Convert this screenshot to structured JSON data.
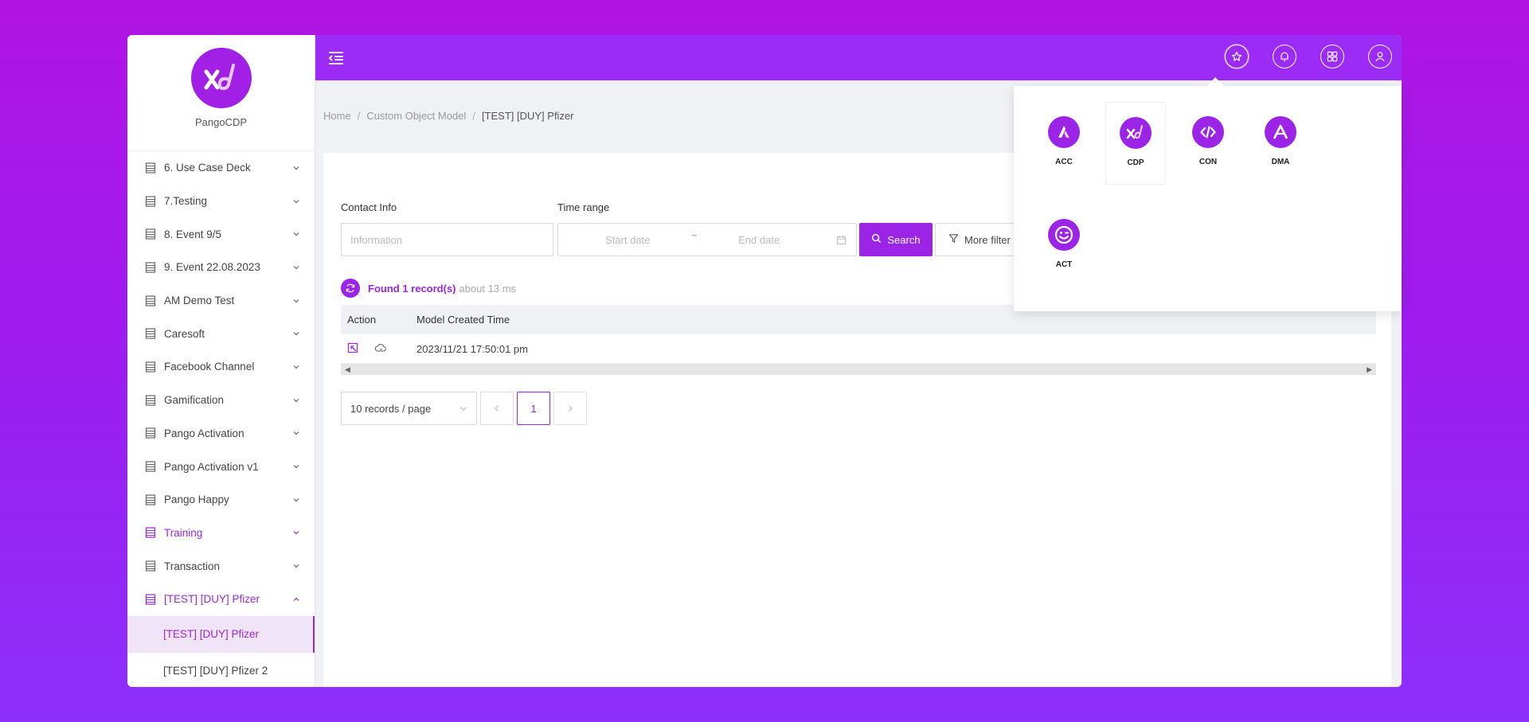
{
  "app": {
    "name": "PangoCDP"
  },
  "sidebar": {
    "items": [
      {
        "label": "6. Use Case Deck",
        "active": false
      },
      {
        "label": "7.Testing",
        "active": false
      },
      {
        "label": "8. Event 9/5",
        "active": false
      },
      {
        "label": "9. Event 22.08.2023",
        "active": false
      },
      {
        "label": "AM Demo Test",
        "active": false
      },
      {
        "label": "Caresoft",
        "active": false
      },
      {
        "label": "Facebook Channel",
        "active": false
      },
      {
        "label": "Gamification",
        "active": false
      },
      {
        "label": "Pango Activation",
        "active": false
      },
      {
        "label": "Pango Activation v1",
        "active": false
      },
      {
        "label": "Pango Happy",
        "active": false
      },
      {
        "label": "Training",
        "active": true
      },
      {
        "label": "Transaction",
        "active": false
      },
      {
        "label": "[TEST] [DUY] Pfizer",
        "active": true,
        "expanded": true
      }
    ],
    "sub_items": [
      {
        "label": "[TEST] [DUY] Pfizer",
        "active": true
      },
      {
        "label": "[TEST] [DUY] Pfizer 2",
        "active": false
      }
    ]
  },
  "breadcrumb": {
    "home": "Home",
    "section": "Custom Object Model",
    "current": "[TEST] [DUY] Pfizer",
    "separator": "/"
  },
  "filters": {
    "contact_label": "Contact Info",
    "contact_placeholder": "Information",
    "time_label": "Time range",
    "start_placeholder": "Start date",
    "end_placeholder": "End date",
    "range_separator": "~",
    "search_label": "Search",
    "more_filter_label": "More filter"
  },
  "results": {
    "found_text": "Found 1 record(s)",
    "took_text": "about 13 ms"
  },
  "table": {
    "columns": [
      "Action",
      "Model Created Time"
    ],
    "rows": [
      {
        "created_time": "2023/11/21 17:50:01 pm"
      }
    ]
  },
  "pagination": {
    "page_size_label": "10 records / page",
    "current_page": "1"
  },
  "apps_menu": {
    "apps": [
      {
        "label": "ACC",
        "icon": "acc-logo-icon",
        "selected": false
      },
      {
        "label": "CDP",
        "icon": "cdp-logo-icon",
        "selected": true
      },
      {
        "label": "CON",
        "icon": "code-icon",
        "selected": false
      },
      {
        "label": "DMA",
        "icon": "dma-logo-icon",
        "selected": false
      },
      {
        "label": "ACT",
        "icon": "smile-icon",
        "selected": false
      }
    ]
  },
  "colors": {
    "brand": "#9b24e6",
    "header": "#9b2bf5",
    "background_gradient": [
      "#b014e2",
      "#8d30fb"
    ]
  }
}
